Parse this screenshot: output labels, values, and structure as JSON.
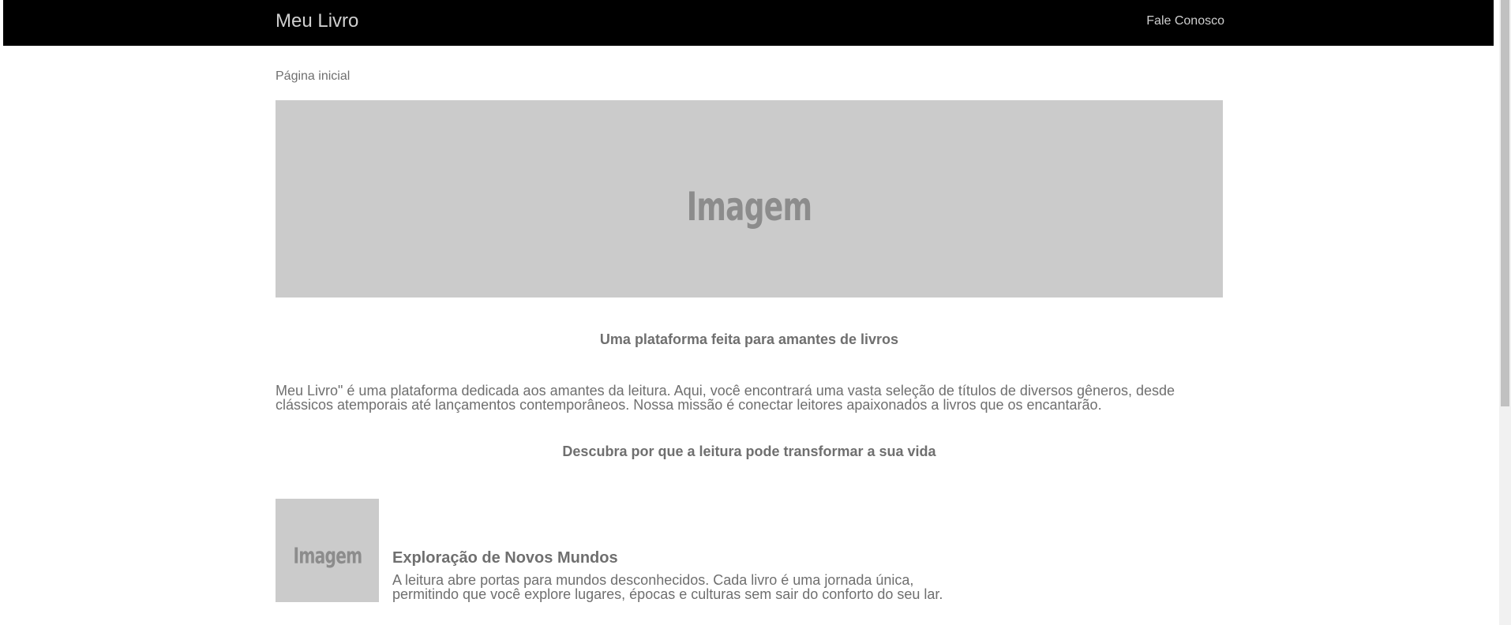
{
  "navbar": {
    "brand": "Meu Livro",
    "contact_link": "Fale Conosco",
    "background_color": "#000000"
  },
  "breadcrumb": {
    "current": "Página inicial"
  },
  "hero": {
    "image_placeholder": "Imagem"
  },
  "main": {
    "tagline": "Uma plataforma feita para amantes de livros",
    "intro": "Meu Livro\" é uma plataforma dedicada aos amantes da leitura. Aqui, você encontrará uma vasta seleção de títulos de diversos gêneros, desde clássicos atemporais até lançamentos contemporâneos. Nossa missão é conectar leitores apaixonados a livros que os encantarão.",
    "section_heading": "Descubra por que a leitura pode transformar a sua vida"
  },
  "features": [
    {
      "image_placeholder": "Imagem",
      "title": "Exploração de Novos Mundos",
      "text": "A leitura abre portas para mundos desconhecidos. Cada livro é uma jornada única, permitindo que você explore lugares, épocas e culturas sem sair do conforto do seu lar."
    }
  ]
}
